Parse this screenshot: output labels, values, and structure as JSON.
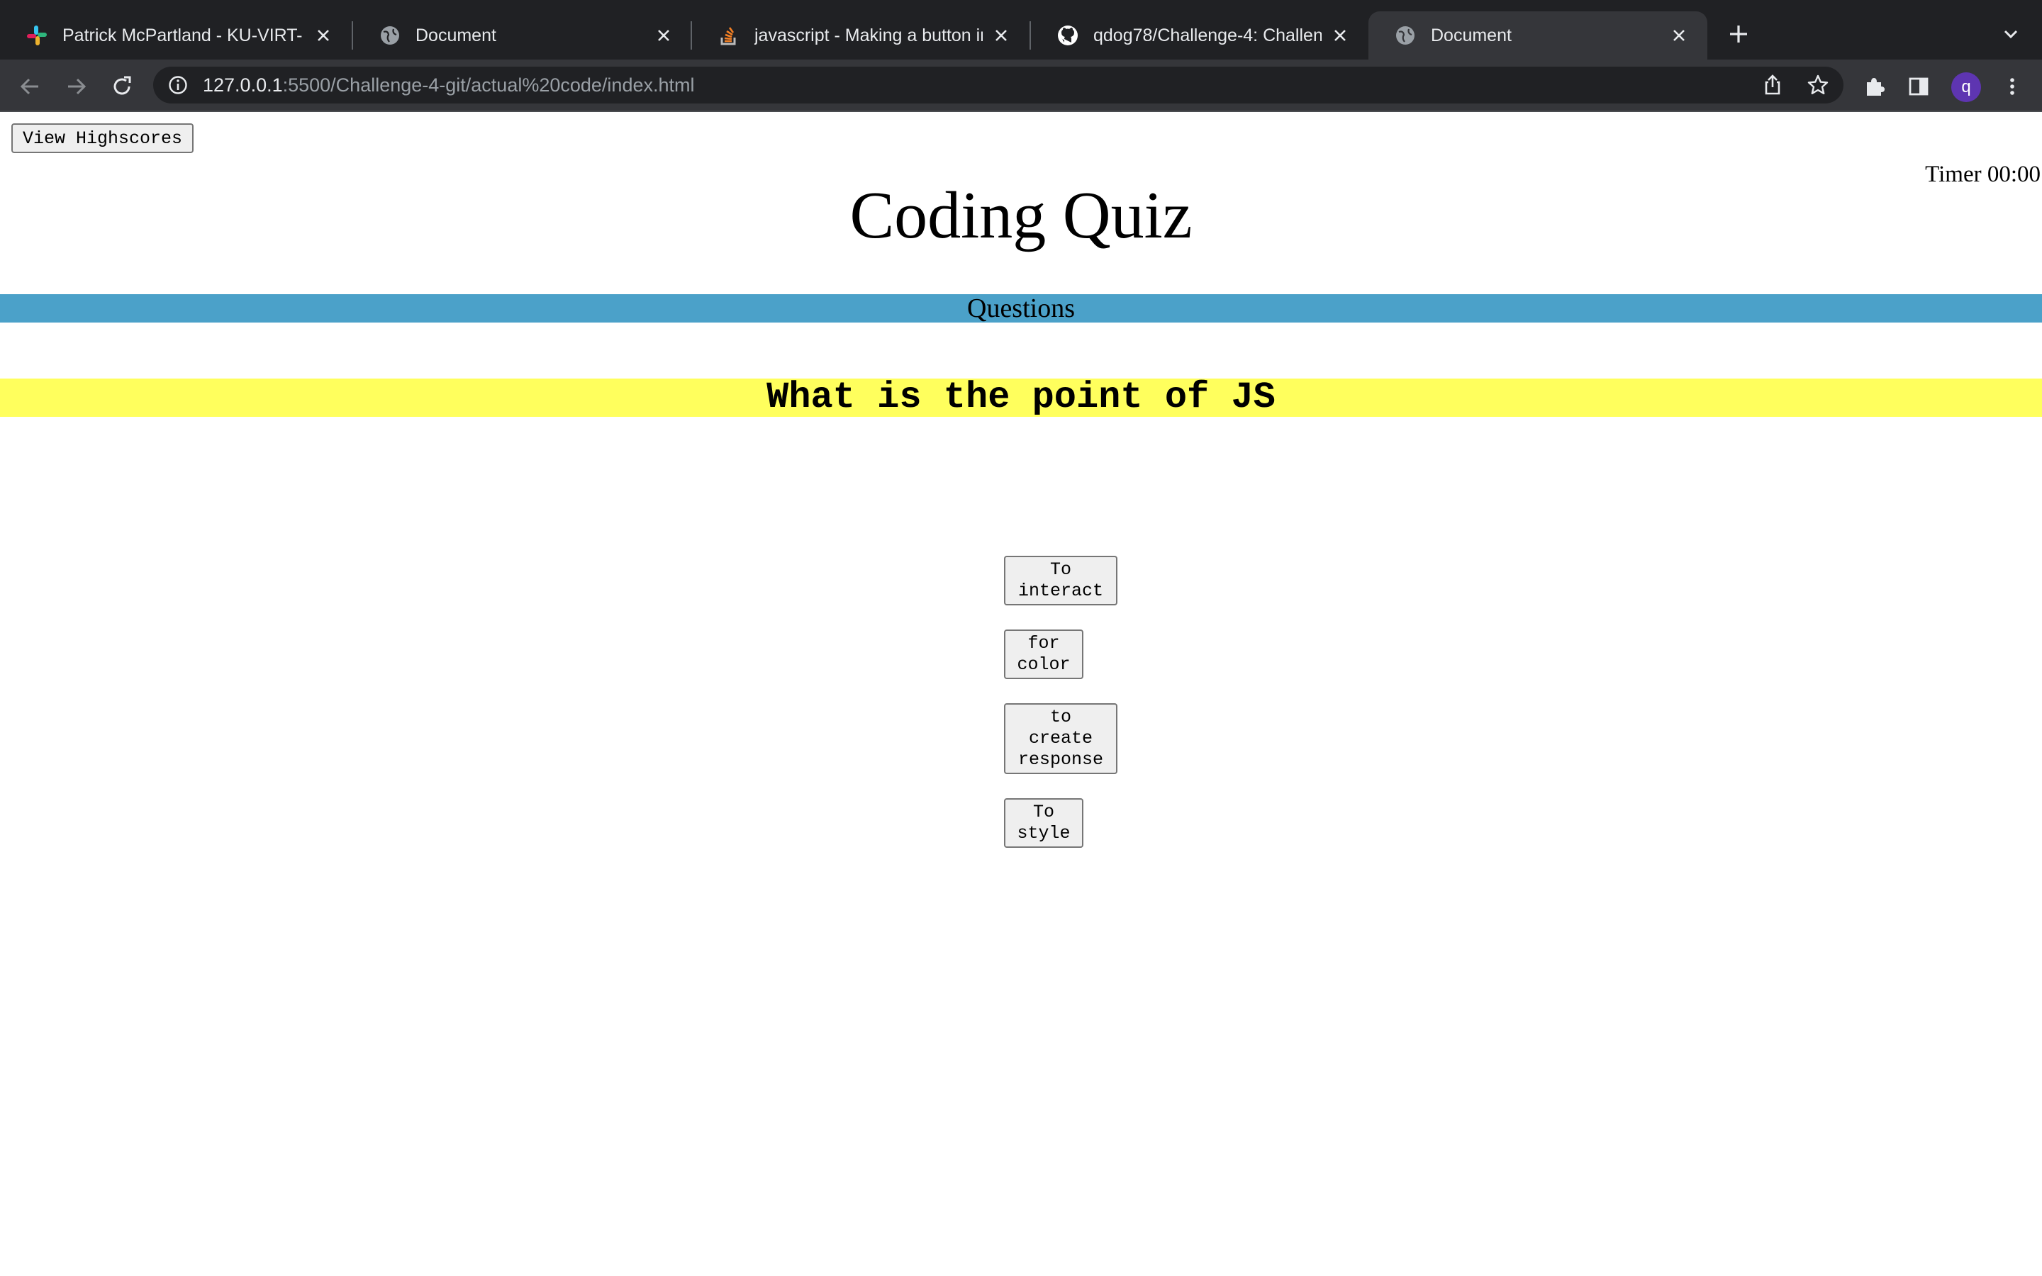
{
  "tabs": [
    {
      "title": "Patrick McPartland - KU-VIRT-",
      "icon": "slack-icon",
      "active": false
    },
    {
      "title": "Document",
      "icon": "globe-icon",
      "active": false
    },
    {
      "title": "javascript - Making a button in",
      "icon": "stackoverflow-icon",
      "active": false
    },
    {
      "title": "qdog78/Challenge-4: Challeng",
      "icon": "github-icon",
      "active": false
    },
    {
      "title": "Document",
      "icon": "globe-icon",
      "active": true
    }
  ],
  "address_bar": {
    "host": "127.0.0.1",
    "path": ":5500/Challenge-4-git/actual%20code/index.html"
  },
  "profile": {
    "initial": "q",
    "color": "#5e35b1"
  },
  "page": {
    "highscores_label": "View Highscores",
    "timer": "Timer 00:00",
    "title": "Coding Quiz",
    "section_label": "Questions",
    "question": "What is the point of JS",
    "answers": [
      "To interact",
      "for color",
      "to create response",
      "To style"
    ]
  },
  "colors": {
    "section_bar": "#4ba1c9",
    "question_bar": "#ffff5d",
    "tabbar_bg": "#202124",
    "toolbar_bg": "#35363a"
  }
}
